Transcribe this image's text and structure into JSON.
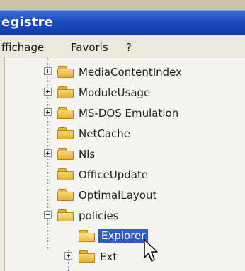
{
  "window": {
    "title": "egistre"
  },
  "menu": {
    "items": [
      "ffichage",
      "Favoris",
      "?"
    ]
  },
  "tree": {
    "items": [
      {
        "label": "MediaContentIndex",
        "expander": "plus",
        "selected": false
      },
      {
        "label": "ModuleUsage",
        "expander": "plus",
        "selected": false
      },
      {
        "label": "MS-DOS Emulation",
        "expander": "plus",
        "selected": false
      },
      {
        "label": "NetCache",
        "expander": "none",
        "selected": false
      },
      {
        "label": "Nls",
        "expander": "plus",
        "selected": false
      },
      {
        "label": "OfficeUpdate",
        "expander": "none",
        "selected": false
      },
      {
        "label": "OptimalLayout",
        "expander": "none",
        "selected": false
      },
      {
        "label": "policies",
        "expander": "minus",
        "selected": false
      },
      {
        "label": "Explorer",
        "expander": "none",
        "selected": true
      },
      {
        "label": "Ext",
        "expander": "plus",
        "selected": false
      }
    ]
  },
  "icons": {
    "folder": "folder-icon",
    "folder_open": "open-folder-icon",
    "cursor": "mouse-pointer-icon"
  },
  "colors": {
    "selection": "#2f5bc4",
    "titlebar": "#1c49c0",
    "folder": "#e4b02f"
  }
}
